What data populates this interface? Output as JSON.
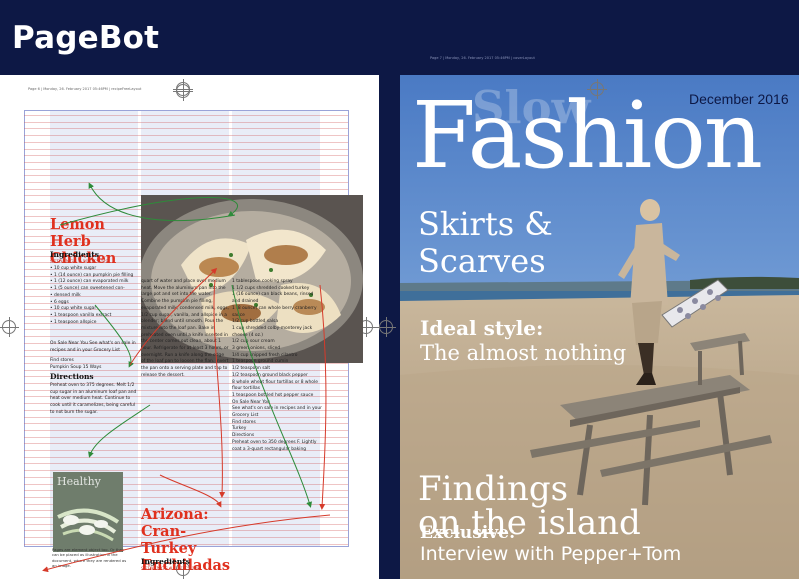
{
  "app": {
    "logo": "PageBot"
  },
  "left_page": {
    "header": "Page 6 | Monday, 26. February 2017 05:46PM | recipeFreeLayout",
    "recipe1": {
      "title": "Lemon Herb Chicken",
      "ingredients_heading": "Ingredients",
      "servings": "SERVINGS 6 UNITS US",
      "ingredients": [
        "10 cup white sugar",
        "1 (14 ounce) can pumpkin pie filling",
        "1 (12 ounce) can evaporated milk",
        "1 (5 ounce) can sweetened con-",
        "densed milk",
        "6 eggs",
        "10 cup white sugar",
        "1 teaspoon vanilla extract",
        "1 teaspoon allspice"
      ],
      "sale_text": "On Sale Near You See what's on sale in recipes and in your Grocery List",
      "find_stores": "Find stores",
      "recipe_name": "Pumpkin Soup 15 Ways",
      "directions_heading": "Directions",
      "directions": "Preheat oven to 375 degrees. Melt 1/2 cup sugar in an aluminum loaf pan and heat over medium heat. Continue to cook until it caramelizes, being careful to not burn the sugar."
    },
    "middle_column": "quart of water and place over medium heat. Move the aluminum pan into the large pot and set into the water. Combine the pumpkin pie filling, evaporated milk, condensed milk, eggs, 1/2 cup sugar, vanilla, and allspice in a blender; blend until smooth. Pour the mixture into the loaf pan. Bake in preheated oven until a knife inserted in the center comes out clean, about 1 hour. Refrigerate for at least 3 hours, or overnight. Run a knife along the edge of the loaf pan to loosen the flan. Invert the pan onto a serving plate and tap to release the dessert.",
    "right_column": "1 tablespoon cooking spray\n1 1/2 cups shredded cooked turkey\n1 (16 ounce) can black beans, rinsed and drained\n1 (8 ounce) can whole berry cranberry sauce\n1/2 cup bottled salsa\n1 cup shredded colby-monterey jack cheese (4 oz.)\n1/2 cup sour cream\n3 green onions, sliced\n1/4 cup snipped fresh cilantro\n1 teaspoon ground cumin\n1/2 teaspoon salt\n1/2 teaspoon ground black pepper\n8 whole wheat flour tortillas or 8 whole flour tortillas\n1 teaspoon bottled hot pepper sauce\nOn Sale Near You\nSee what's on sale in recipes and in your Grocery List\nFind stores\nTurkey\nDirections\nPreheat oven to 350 degrees F. Lightly coat a 3-quart rectangular baking",
    "mini_cover_title": "Healthy",
    "caption": "Pages are element object too. Or they can be placed as illustration in the document, where they are rendered as an image.",
    "recipe2": {
      "title": "Arizona: Cran-Turkey Enchiladas",
      "ingredients_heading": "Ingredients",
      "servings": "SERVINGS 8 UNITS US"
    }
  },
  "right_page": {
    "header": "Page 7 | Monday, 26. February 2017 05:46PM | coverLayout",
    "date": "December 2016",
    "slow": "Slow",
    "title": "Fashion",
    "headline1_line1": "Skirts &",
    "headline1_line2": "Scarves",
    "headline2_bold": "Ideal style:",
    "headline2_sub": "The almost nothing",
    "headline3_line1": "Findings",
    "headline3_line2": "on the island",
    "headline4_bold": "Exclusive:",
    "headline4_sub": "Interview with Pepper+Tom"
  },
  "colors": {
    "background": "#0d1845",
    "recipe_title": "#e0301e",
    "date_text": "#0d1845"
  }
}
